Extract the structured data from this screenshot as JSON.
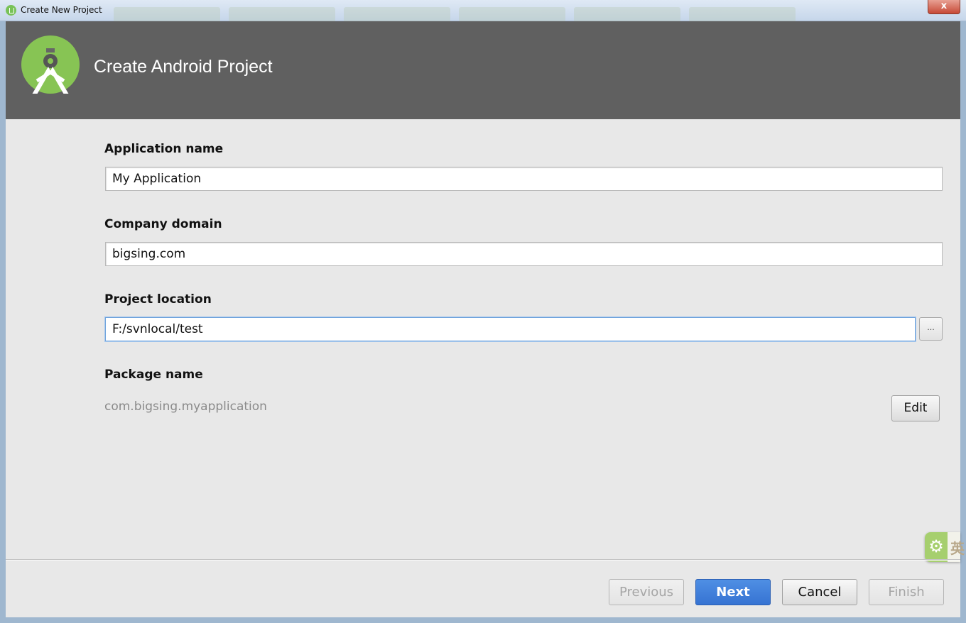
{
  "titlebar": {
    "title": "Create New Project",
    "close_label": "x"
  },
  "header": {
    "title": "Create Android Project"
  },
  "form": {
    "app_name": {
      "label": "Application name",
      "value": "My Application"
    },
    "company_domain": {
      "label": "Company domain",
      "value": "bigsing.com"
    },
    "project_location": {
      "label": "Project location",
      "value": "F:/svnlocal/test",
      "browse_label": "..."
    },
    "package_name": {
      "label": "Package name",
      "value": "com.bigsing.myapplication",
      "edit_label": "Edit"
    }
  },
  "ime": {
    "text": "英"
  },
  "footer": {
    "previous_label": "Previous",
    "next_label": "Next",
    "cancel_label": "Cancel",
    "finish_label": "Finish"
  },
  "colors": {
    "header_bg": "#606060",
    "logo_green": "#87c454",
    "primary_button": "#3e7fdc"
  },
  "icons": {
    "logo": "android-studio-icon",
    "ime": "gear-icon"
  }
}
